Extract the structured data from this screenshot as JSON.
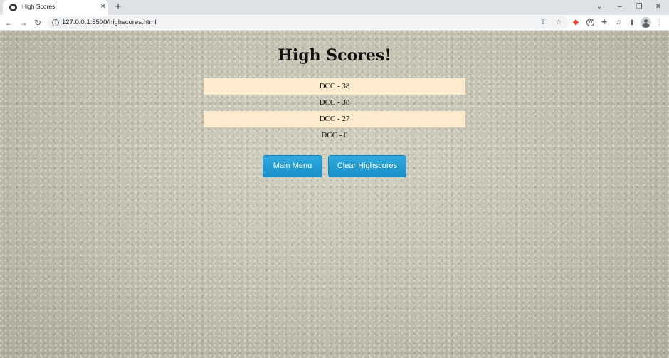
{
  "browser": {
    "tab_title": "High Scores!",
    "tab_close_glyph": "✕",
    "new_tab_glyph": "+",
    "url": "127.0.0.1:5500/highscores.html",
    "window_controls": {
      "list": "⌄",
      "minimize": "–",
      "restore": "❐",
      "close": "✕"
    },
    "nav": {
      "back": "←",
      "forward": "→",
      "reload": "↻"
    },
    "site_info_glyph": "i",
    "share_glyph": "⇪",
    "bookmark_glyph": "☆",
    "extensions": {
      "red_ext": "◆",
      "wp": "W",
      "puzzle": "✚",
      "media": "♫",
      "side_panel": "▮",
      "menu": "⋮"
    }
  },
  "page": {
    "title": "High Scores!",
    "scores": [
      "DCC - 38",
      "DCC - 38",
      "DCC - 27",
      "DCC - 0"
    ],
    "buttons": {
      "main_menu": "Main Menu",
      "clear": "Clear Highscores"
    }
  },
  "colors": {
    "row_highlight": "#feebcd",
    "button_blue": "#1f9bd4",
    "button_text": "#ffffff"
  }
}
